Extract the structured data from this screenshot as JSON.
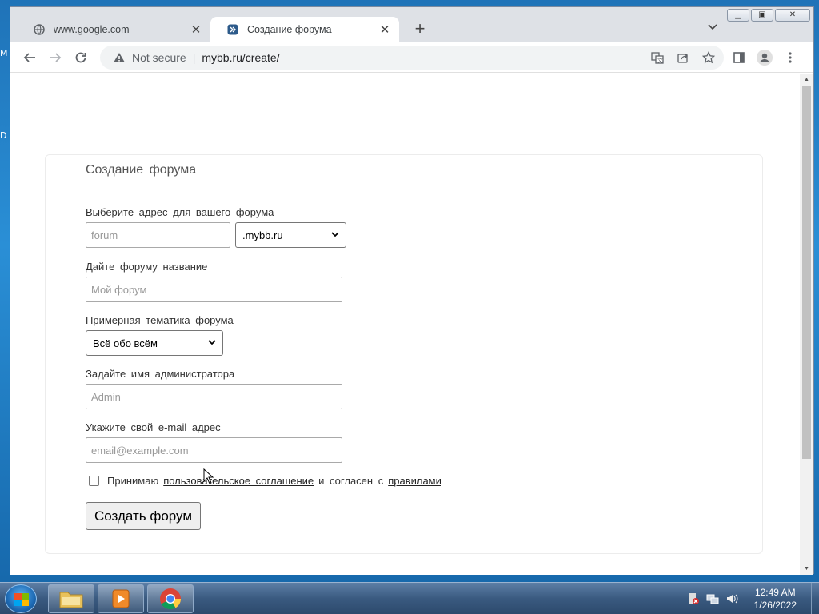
{
  "desktop": {
    "fragments": [
      "M",
      "D"
    ]
  },
  "browser": {
    "tabs": [
      {
        "title": "www.google.com",
        "active": false
      },
      {
        "title": "Создание форума",
        "active": true
      }
    ],
    "new_tab": "+",
    "omnibox": {
      "security": "Not secure",
      "url": "mybb.ru/create/"
    }
  },
  "page": {
    "card_title": "Создание форума",
    "address": {
      "label": "Выберите адрес для вашего форума",
      "placeholder": "forum",
      "domain_selected": ".mybb.ru"
    },
    "name": {
      "label": "Дайте форуму название",
      "placeholder": "Мой форум"
    },
    "topic": {
      "label": "Примерная тематика форума",
      "selected": "Всё обо всём"
    },
    "admin": {
      "label": "Задайте имя администратора",
      "placeholder": "Admin"
    },
    "email": {
      "label": "Укажите свой e-mail адрес",
      "placeholder": "email@example.com"
    },
    "agree": {
      "prefix": "Принимаю",
      "agreement_link": "пользовательское соглашение",
      "middle": "и согласен с",
      "rules_link": "правилами",
      "checked": false
    },
    "submit": "Создать форум"
  },
  "taskbar": {
    "time": "12:49 AM",
    "date": "1/26/2022"
  }
}
